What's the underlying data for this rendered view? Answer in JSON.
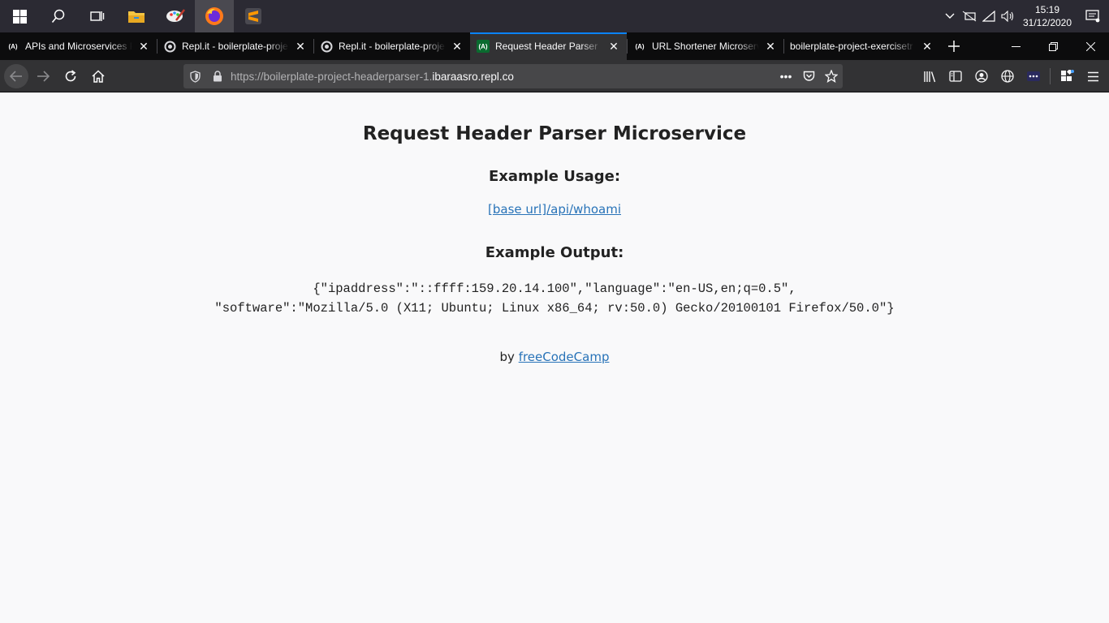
{
  "taskbar": {
    "apps": [
      "start",
      "search",
      "task-view",
      "file-explorer",
      "paint-app",
      "firefox",
      "sublime-text"
    ],
    "clock_time": "15:19",
    "clock_date": "31/12/2020"
  },
  "tabs": [
    {
      "title": "APIs and Microservices P",
      "favicon": "freecodecamp"
    },
    {
      "title": "Repl.it - boilerplate-proje",
      "favicon": "replit"
    },
    {
      "title": "Repl.it - boilerplate-proje",
      "favicon": "replit"
    },
    {
      "title": "Request Header Parser",
      "favicon": "freecodecamp",
      "selected": true
    },
    {
      "title": "URL Shortener Microserv",
      "favicon": "freecodecamp"
    },
    {
      "title": "boilerplate-project-exercisetr",
      "favicon": "none"
    }
  ],
  "urlbar": {
    "prefix": "https://boilerplate-project-headerparser-1.",
    "host": "ibaraasro.repl.co"
  },
  "page": {
    "title": "Request Header Parser Microservice",
    "usage_heading": "Example Usage:",
    "usage_link": "[base url]/api/whoami",
    "output_heading": "Example Output:",
    "output_line1": "{\"ipaddress\":\"::ffff:159.20.14.100\",\"language\":\"en-US,en;q=0.5\",",
    "output_line2": "\"software\":\"Mozilla/5.0 (X11; Ubuntu; Linux x86_64; rv:50.0) Gecko/20100101 Firefox/50.0\"}",
    "by_text": "by ",
    "by_link": "freeCodeCamp"
  },
  "colors": {
    "link": "#2873b8",
    "tab_accent": "#0a84ff",
    "firefox_chrome": "#323234"
  }
}
